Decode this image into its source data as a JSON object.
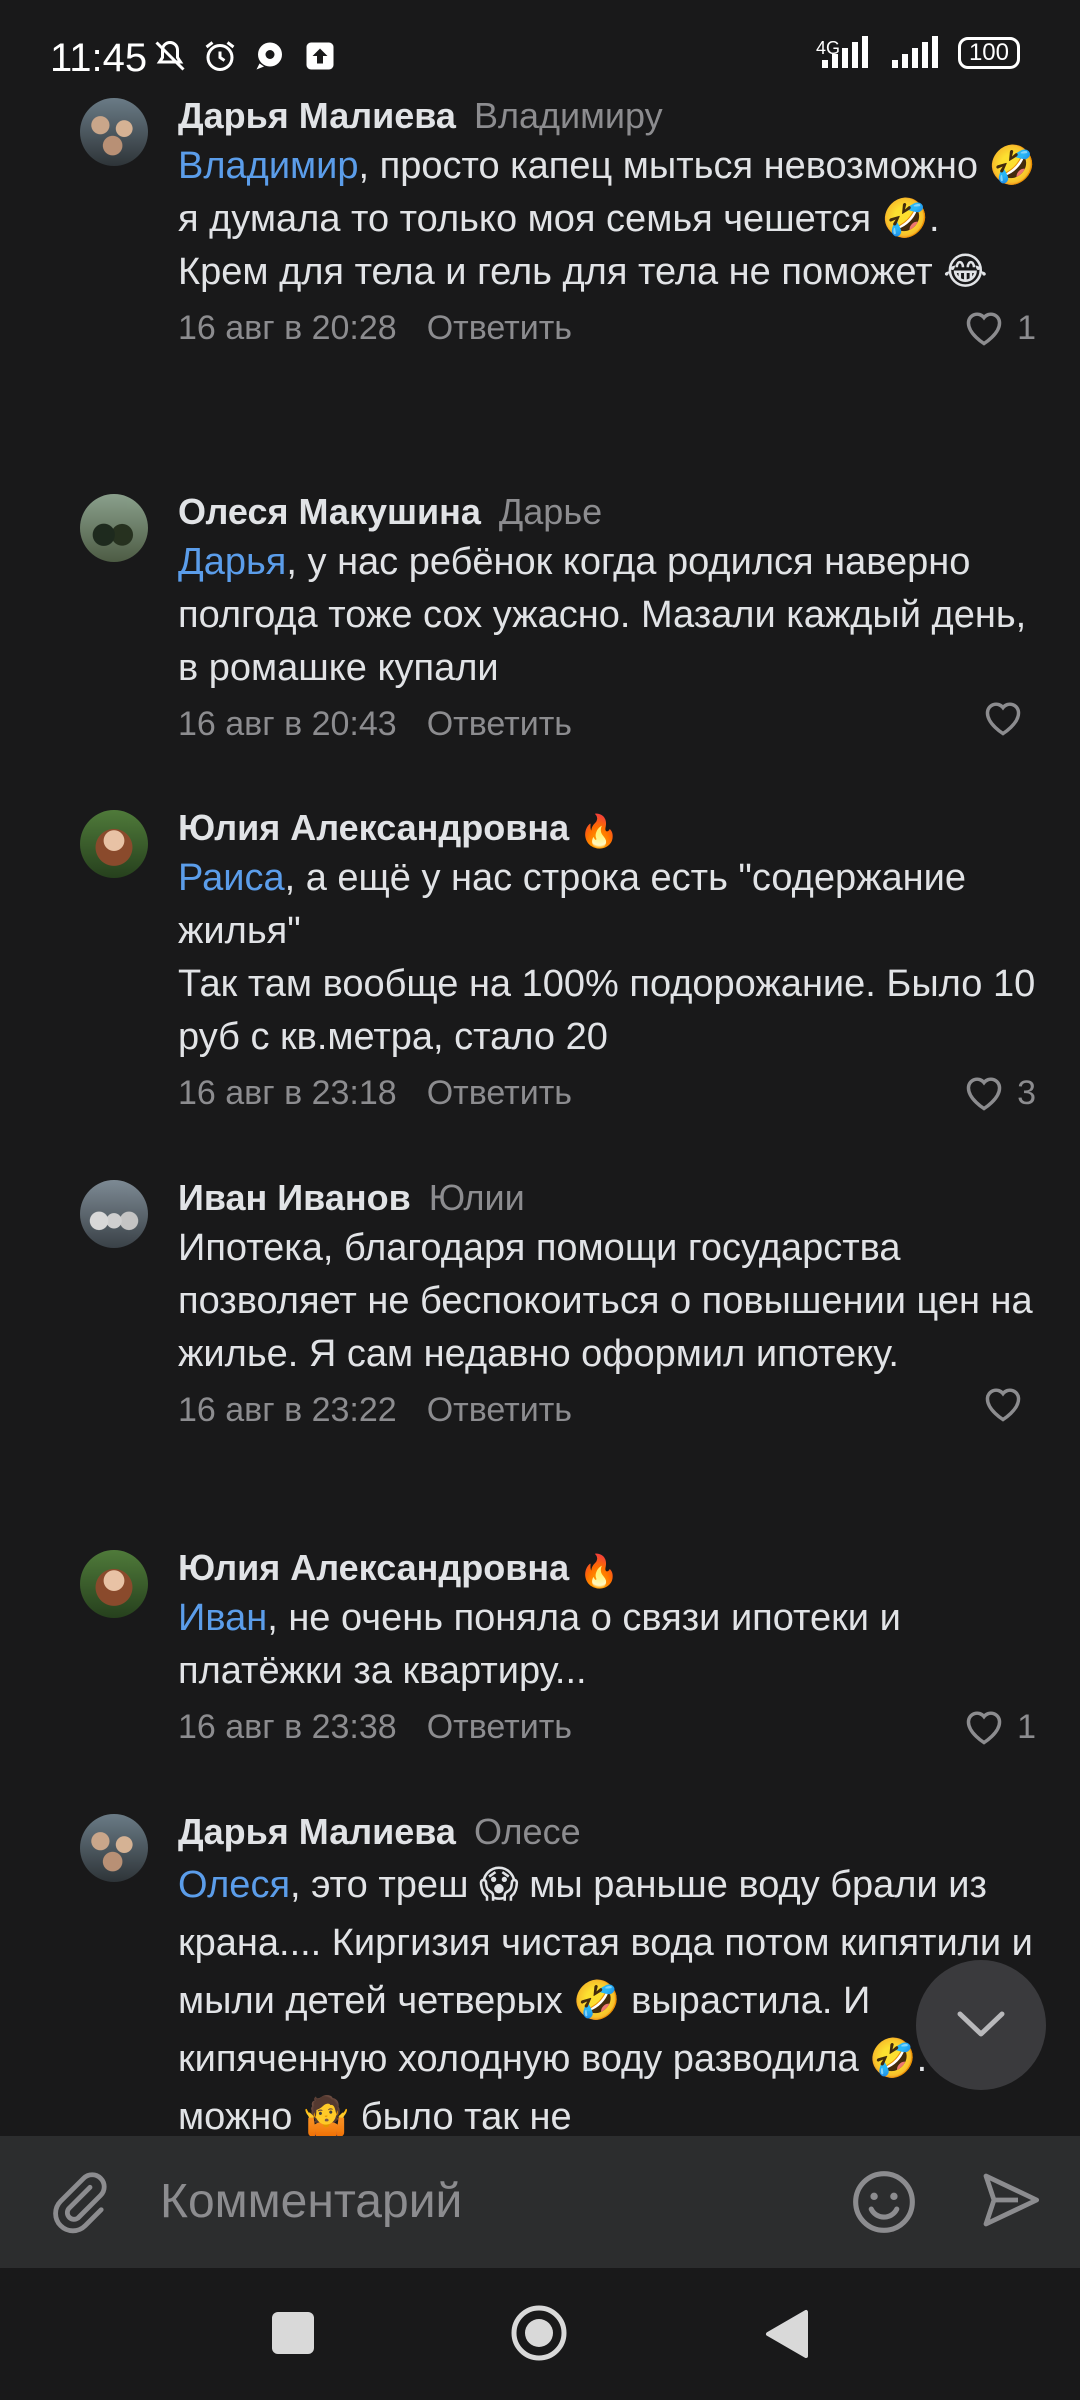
{
  "status_bar": {
    "time": "11:45",
    "network": "4G",
    "battery": "100",
    "icons": [
      "notifications-off-icon",
      "alarm-icon",
      "chat-bubble-icon",
      "upload-icon",
      "signal-icon",
      "signal-icon",
      "battery-icon"
    ]
  },
  "comments": [
    {
      "author": "Дарья Малиева",
      "reply_to": "Владимиру",
      "mention": "Владимир",
      "text": ", просто капец мыться невозможно 🤣 я думала то только моя семья  чешется 🤣. Крем для тела и гель для тела не поможет 😂",
      "date": "16 авг в 20:28",
      "reply_label": "Ответить",
      "likes": "1",
      "badge": ""
    },
    {
      "author": "Олеся Макушина",
      "reply_to": "Дарье",
      "mention": "Дарья",
      "text": ", у нас ребёнок когда родился наверно полгода тоже сох ужасно. Мазали каждый день, в ромашке купали",
      "date": "16 авг в 20:43",
      "reply_label": "Ответить",
      "likes": "",
      "badge": ""
    },
    {
      "author": "Юлия Александровна",
      "reply_to": "",
      "mention": "Раиса",
      "text": ", а ещё у нас строка есть \"содержание жилья\"\n Так там вообще на 100% подорожание. Было 10 руб с кв.метра, стало 20",
      "date": "16 авг в 23:18",
      "reply_label": "Ответить",
      "likes": "3",
      "badge": "🔥"
    },
    {
      "author": "Иван Иванов",
      "reply_to": "Юлии",
      "mention": "",
      "text": "Ипотека, благодаря помощи государства позволяет не беспокоиться о повышении цен на жилье. Я сам недавно оформил ипотеку.",
      "date": "16 авг в 23:22",
      "reply_label": "Ответить",
      "likes": "",
      "badge": ""
    },
    {
      "author": "Юлия Александровна",
      "reply_to": "",
      "mention": "Иван",
      "text": ", не очень поняла о связи ипотеки и платёжки за квартиру...",
      "date": "16 авг в 23:38",
      "reply_label": "Ответить",
      "likes": "1",
      "badge": "🔥"
    },
    {
      "author": "Дарья Малиева",
      "reply_to": "Олесе",
      "mention": "Олеся",
      "text": ", это треш 😱 мы раньше воду брали из крана.... Киргизия чистая вода потом кипятили и мыли детей четверых 🤣 вырастила. И кипяченную холодную воду разводила 🤣. Хотя можно 🤷 было так не",
      "date": "",
      "reply_label": "",
      "likes": "",
      "badge": ""
    }
  ],
  "input": {
    "placeholder": "Комментарий"
  },
  "colors": {
    "background": "#19191a",
    "text": "#e1e3e6",
    "secondary": "#8c8c8f",
    "mention": "#5b9dea",
    "input_bar": "#2c2d2e"
  }
}
